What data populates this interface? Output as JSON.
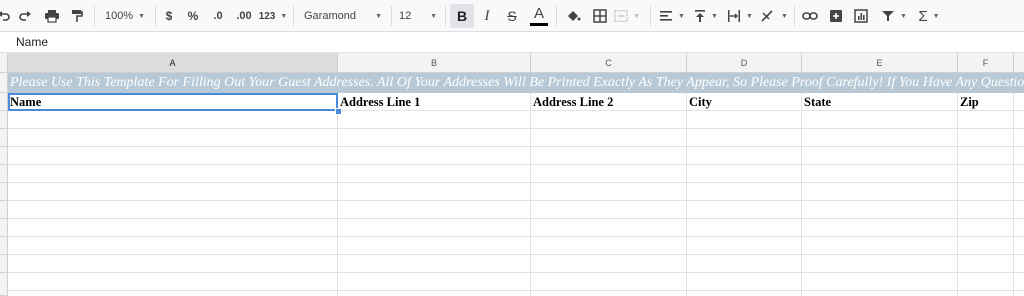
{
  "toolbar": {
    "zoom": "100%",
    "currency": "$",
    "percent": "%",
    "decrease_decimal": ".0",
    "increase_decimal": ".00",
    "more_formats": "123",
    "font": "Garamond",
    "font_size": "12",
    "bold": "B",
    "italic": "I",
    "strikethrough": "S",
    "text_color": "A",
    "sum": "Σ"
  },
  "formula_bar": {
    "value": "Name"
  },
  "columns": [
    "A",
    "B",
    "C",
    "D",
    "E",
    "F"
  ],
  "banner": "Please Use This Template For Filling Out Your Guest Addresses. All Of Your Addresses Will Be Printed Exactly As They Appear, So Please Proof Carefully! If You Have Any Questions Ab",
  "headers": [
    "Name",
    "Address Line 1",
    "Address Line 2",
    "City",
    "State",
    "Zip"
  ],
  "colors": {
    "banner_bg": "#b7c9d6",
    "selection": "#4a89dc"
  }
}
